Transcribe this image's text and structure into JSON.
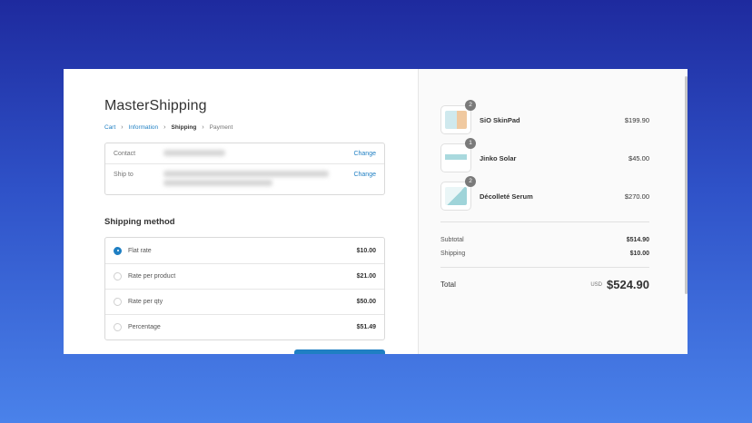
{
  "store": {
    "title": "MasterShipping"
  },
  "breadcrumb": [
    {
      "label": "Cart",
      "state": "link"
    },
    {
      "label": "Information",
      "state": "link"
    },
    {
      "label": "Shipping",
      "state": "current"
    },
    {
      "label": "Payment",
      "state": "upcoming"
    }
  ],
  "review": {
    "contact_label": "Contact",
    "ship_to_label": "Ship to",
    "change_label": "Change"
  },
  "shipping": {
    "heading": "Shipping method",
    "rates": [
      {
        "name": "Flat rate",
        "price": "$10.00",
        "selected": true
      },
      {
        "name": "Rate per product",
        "price": "$21.00",
        "selected": false
      },
      {
        "name": "Rate per qty",
        "price": "$50.00",
        "selected": false
      },
      {
        "name": "Percentage",
        "price": "$51.49",
        "selected": false
      }
    ]
  },
  "cart": {
    "items": [
      {
        "name": "SiO SkinPad",
        "qty": "2",
        "price": "$199.90",
        "icon": "skinpad-product-image"
      },
      {
        "name": "Jinko Solar",
        "qty": "1",
        "price": "$45.00",
        "icon": "solar-product-image"
      },
      {
        "name": "Décolleté Serum",
        "qty": "2",
        "price": "$270.00",
        "icon": "serum-product-image"
      }
    ],
    "subtotal_label": "Subtotal",
    "subtotal": "$514.90",
    "shipping_label": "Shipping",
    "shipping": "$10.00",
    "total_label": "Total",
    "currency": "USD",
    "total": "$524.90"
  },
  "colors": {
    "accent": "#1f7fc3",
    "bg_top": "#1e2a9e",
    "bg_bottom": "#4a82ea"
  }
}
